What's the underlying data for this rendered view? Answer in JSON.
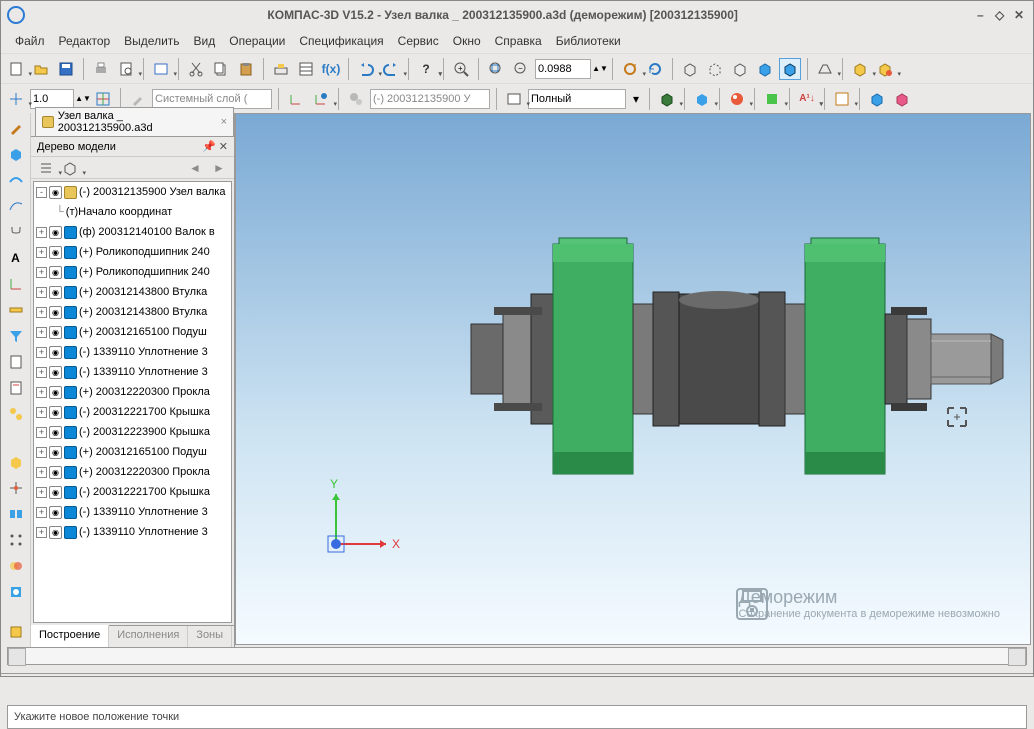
{
  "title": "КОМПАС-3D V15.2  - Узел валка _ 200312135900.a3d (деморежим) [200312135900]",
  "menu": [
    "Файл",
    "Редактор",
    "Выделить",
    "Вид",
    "Операции",
    "Спецификация",
    "Сервис",
    "Окно",
    "Справка",
    "Библиотеки"
  ],
  "toolbar2": {
    "num": "1.0",
    "layer": "Системный слой ( ",
    "ref": "(-) 200312135900 У",
    "display": "Полный"
  },
  "zoom": "0.0988",
  "filetab": "Узел валка _ 200312135900.a3d",
  "panel_title": "Дерево модели",
  "tree": [
    {
      "pm": "-",
      "icon": "doc",
      "label": "(-) 200312135900 Узел валка "
    },
    {
      "pm": "",
      "icon": "none",
      "indent": 1,
      "label": "(т)Начало координат"
    },
    {
      "pm": "+",
      "icon": "cube",
      "label": "(ф) 200312140100 Валок в"
    },
    {
      "pm": "+",
      "icon": "cube",
      "label": "(+) Роликоподшипник 240"
    },
    {
      "pm": "+",
      "icon": "cube",
      "label": "(+) Роликоподшипник 240"
    },
    {
      "pm": "+",
      "icon": "cube",
      "label": "(+) 200312143800 Втулка"
    },
    {
      "pm": "+",
      "icon": "cube",
      "label": "(+) 200312143800 Втулка"
    },
    {
      "pm": "+",
      "icon": "cube",
      "label": "(+) 200312165100 Подуш"
    },
    {
      "pm": "+",
      "icon": "cube",
      "label": "(-) 1339110 Уплотнение 3"
    },
    {
      "pm": "+",
      "icon": "cube",
      "label": "(-) 1339110 Уплотнение 3"
    },
    {
      "pm": "+",
      "icon": "cube",
      "label": "(+) 200312220300 Прокла"
    },
    {
      "pm": "+",
      "icon": "cube",
      "label": "(-) 200312221700 Крышка"
    },
    {
      "pm": "+",
      "icon": "cube",
      "label": "(-) 200312223900 Крышка"
    },
    {
      "pm": "+",
      "icon": "cube",
      "label": "(+) 200312165100 Подуш"
    },
    {
      "pm": "+",
      "icon": "cube",
      "label": "(+) 200312220300 Прокла"
    },
    {
      "pm": "+",
      "icon": "cube",
      "label": "(-) 200312221700 Крышка"
    },
    {
      "pm": "+",
      "icon": "cube",
      "label": "(-) 1339110 Уплотнение 3"
    },
    {
      "pm": "+",
      "icon": "cube",
      "label": "(-) 1339110 Уплотнение 3"
    }
  ],
  "bottom_tabs": [
    "Построение",
    "Исполнения",
    "Зоны"
  ],
  "demo": {
    "big": "Деморежим",
    "small": "Сохранение документа в деморежиме невозможно"
  },
  "axis": {
    "x": "X",
    "y": "Y"
  },
  "status": "Укажите новое положение точки"
}
